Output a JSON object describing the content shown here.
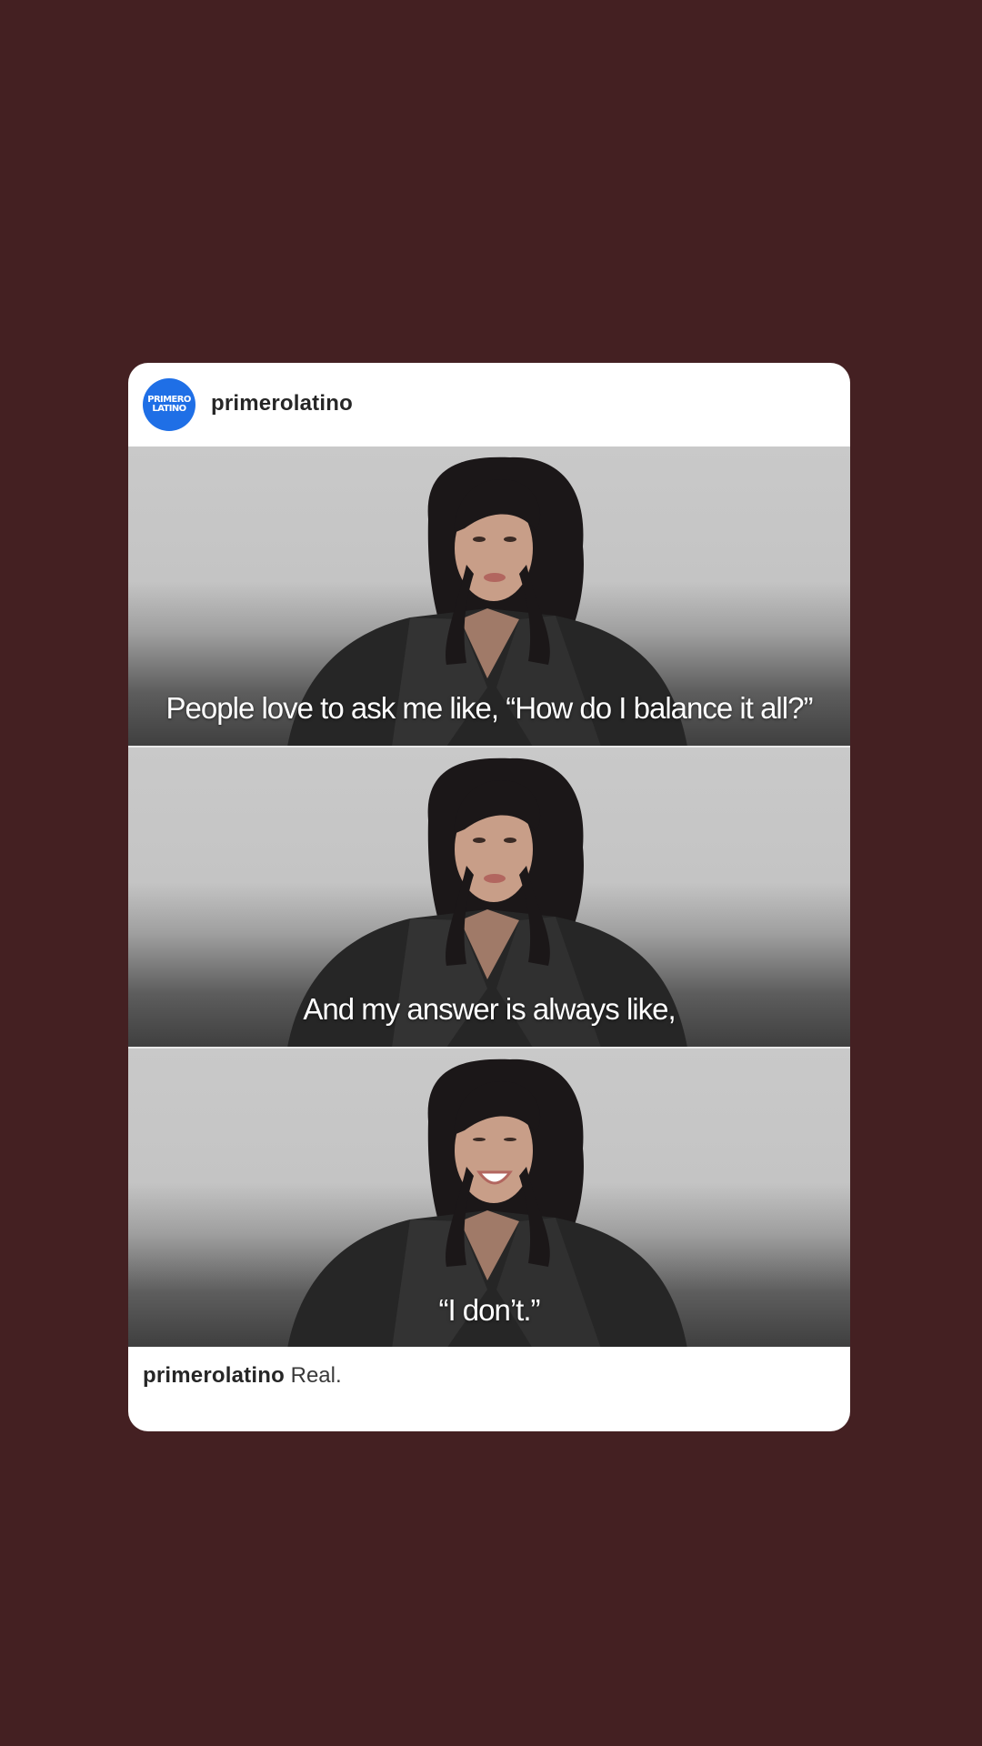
{
  "post": {
    "username": "primerolatino",
    "avatar": {
      "logo_line_1": "PRIMERO",
      "logo_line_2": "LATINO",
      "color": "#1f6fe6"
    },
    "frames": [
      {
        "caption": "People love to ask me like, “How do I balance it all?”"
      },
      {
        "caption": "And my answer is always like,"
      },
      {
        "caption": "“I don’t.”"
      }
    ],
    "footer": {
      "username": "primerolatino",
      "caption": "Real."
    }
  },
  "colors": {
    "background": "#442022",
    "card": "#ffffff",
    "text": "#262626"
  }
}
